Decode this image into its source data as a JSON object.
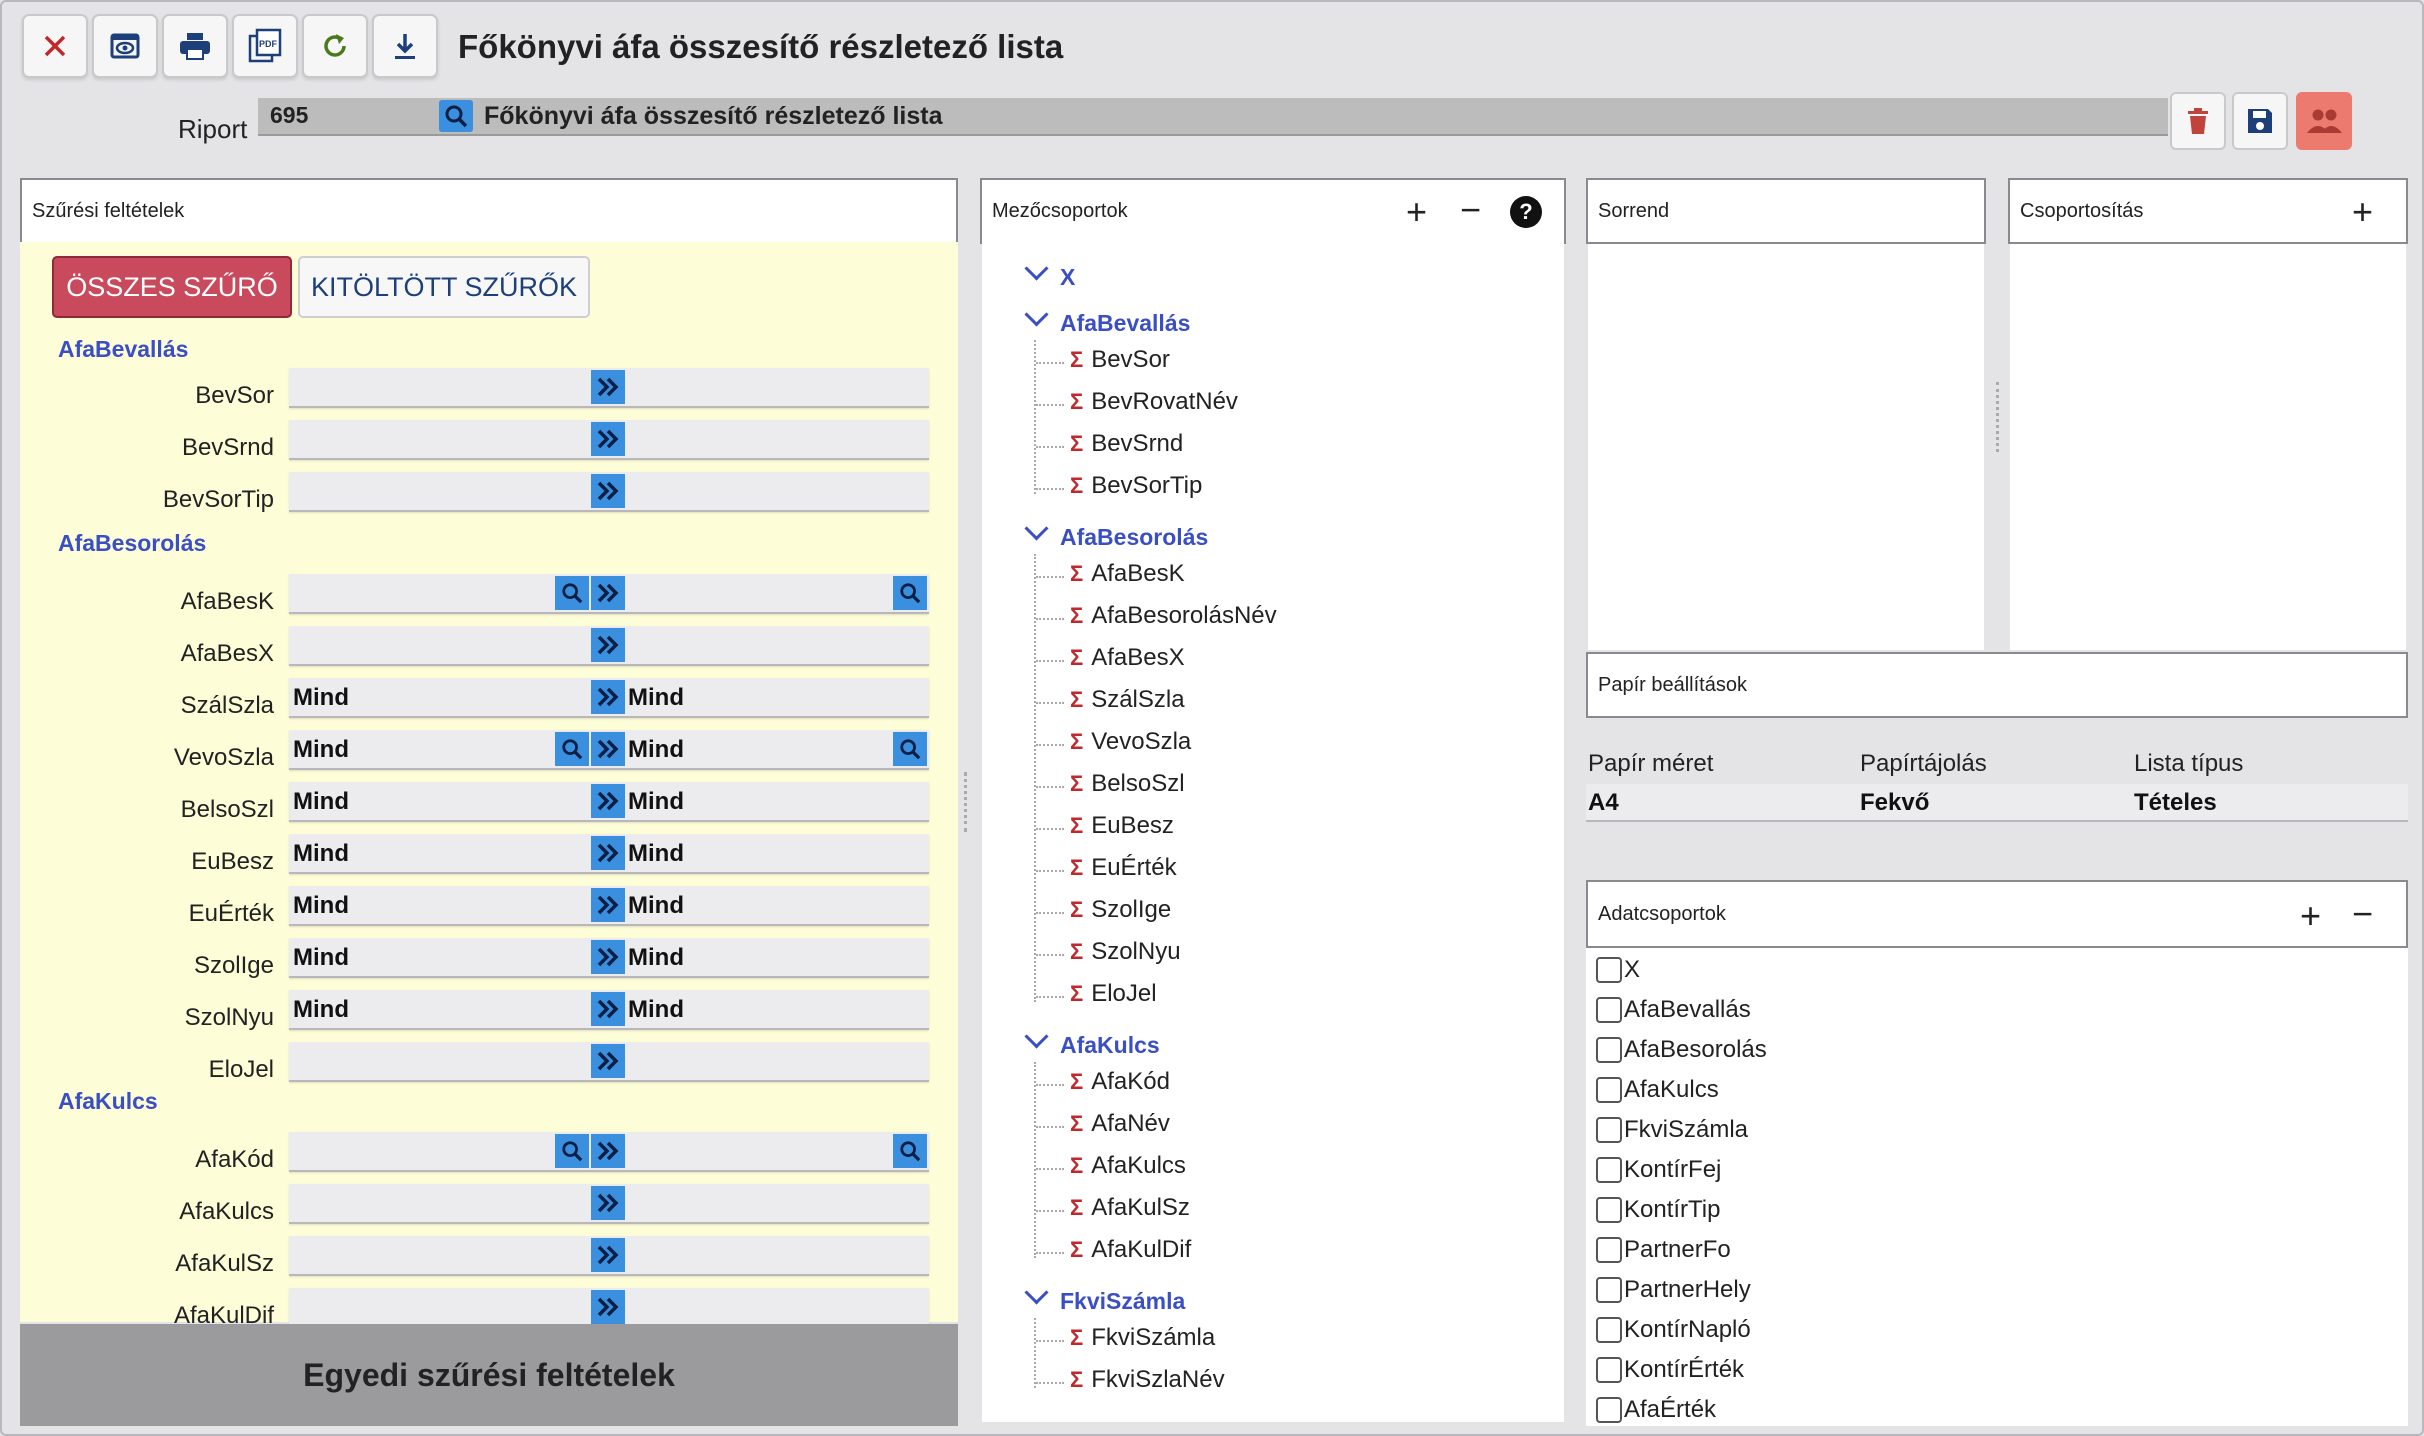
{
  "toolbar": {
    "buttons": [
      "close-icon",
      "preview-icon",
      "print-icon",
      "pdf-icon",
      "refresh-icon",
      "download-icon"
    ],
    "pdf_text": "PDF"
  },
  "title": "Főkönyvi áfa összesítő részletező lista",
  "riport": {
    "label": "Riport",
    "number": "695",
    "name": "Főkönyvi áfa összesítő részletező lista"
  },
  "filters": {
    "header": "Szűrési feltételek",
    "tab_all": "ÖSSZES SZŰRŐ",
    "tab_filled": "KITÖLTÖTT SZŰRŐK",
    "groups": [
      {
        "name": "AfaBevallás"
      },
      {
        "name": "AfaBesorolás"
      },
      {
        "name": "AfaKulcs"
      }
    ],
    "rows": [
      {
        "label": "BevSor",
        "from": "",
        "to": ""
      },
      {
        "label": "BevSrnd",
        "from": "",
        "to": ""
      },
      {
        "label": "BevSorTip",
        "from": "",
        "to": ""
      },
      {
        "label": "AfaBesK",
        "from": "",
        "to": ""
      },
      {
        "label": "AfaBesX",
        "from": "",
        "to": ""
      },
      {
        "label": "SzálSzla",
        "from": "Mind",
        "to": "Mind"
      },
      {
        "label": "VevoSzla",
        "from": "Mind",
        "to": "Mind"
      },
      {
        "label": "BelsoSzl",
        "from": "Mind",
        "to": "Mind"
      },
      {
        "label": "EuBesz",
        "from": "Mind",
        "to": "Mind"
      },
      {
        "label": "EuÉrték",
        "from": "Mind",
        "to": "Mind"
      },
      {
        "label": "SzolIge",
        "from": "Mind",
        "to": "Mind"
      },
      {
        "label": "SzolNyu",
        "from": "Mind",
        "to": "Mind"
      },
      {
        "label": "EloJel",
        "from": "",
        "to": ""
      },
      {
        "label": "AfaKód",
        "from": "",
        "to": ""
      },
      {
        "label": "AfaKulcs",
        "from": "",
        "to": ""
      },
      {
        "label": "AfaKulSz",
        "from": "",
        "to": ""
      },
      {
        "label": "AfaKulDif",
        "from": "",
        "to": ""
      }
    ],
    "custom": "Egyedi szűrési feltételek"
  },
  "fields": {
    "header": "Mezőcsoportok",
    "groups": [
      {
        "name": "X",
        "items": []
      },
      {
        "name": "AfaBevallás",
        "items": [
          "BevSor",
          "BevRovatNév",
          "BevSrnd",
          "BevSorTip"
        ]
      },
      {
        "name": "AfaBesorolás",
        "items": [
          "AfaBesK",
          "AfaBesorolásNév",
          "AfaBesX",
          "SzálSzla",
          "VevoSzla",
          "BelsoSzl",
          "EuBesz",
          "EuÉrték",
          "SzolIge",
          "SzolNyu",
          "EloJel"
        ]
      },
      {
        "name": "AfaKulcs",
        "items": [
          "AfaKód",
          "AfaNév",
          "AfaKulcs",
          "AfaKulSz",
          "AfaKulDif"
        ]
      },
      {
        "name": "FkviSzámla",
        "items": [
          "FkviSzámla",
          "FkviSzlaNév"
        ]
      }
    ]
  },
  "sort": {
    "header": "Sorrend"
  },
  "grouping": {
    "header": "Csoportosítás"
  },
  "paper": {
    "header": "Papír beállítások",
    "columns": [
      "Papír méret",
      "Papírtájolás",
      "Lista típus"
    ],
    "values": [
      "A4",
      "Fekvő",
      "Tételes"
    ]
  },
  "datagroups": {
    "header": "Adatcsoportok",
    "items": [
      "X",
      "AfaBevallás",
      "AfaBesorolás",
      "AfaKulcs",
      "FkviSzámla",
      "KontírFej",
      "KontírTip",
      "PartnerFo",
      "PartnerHely",
      "KontírNapló",
      "KontírÉrték",
      "AfaÉrték"
    ]
  },
  "colors": {
    "accent": "#3a8fde",
    "group_text": "#3b4fc4",
    "tab_active": "#c94a5c",
    "filter_bg": "#fdfdd8",
    "sigma": "#c0282b"
  }
}
